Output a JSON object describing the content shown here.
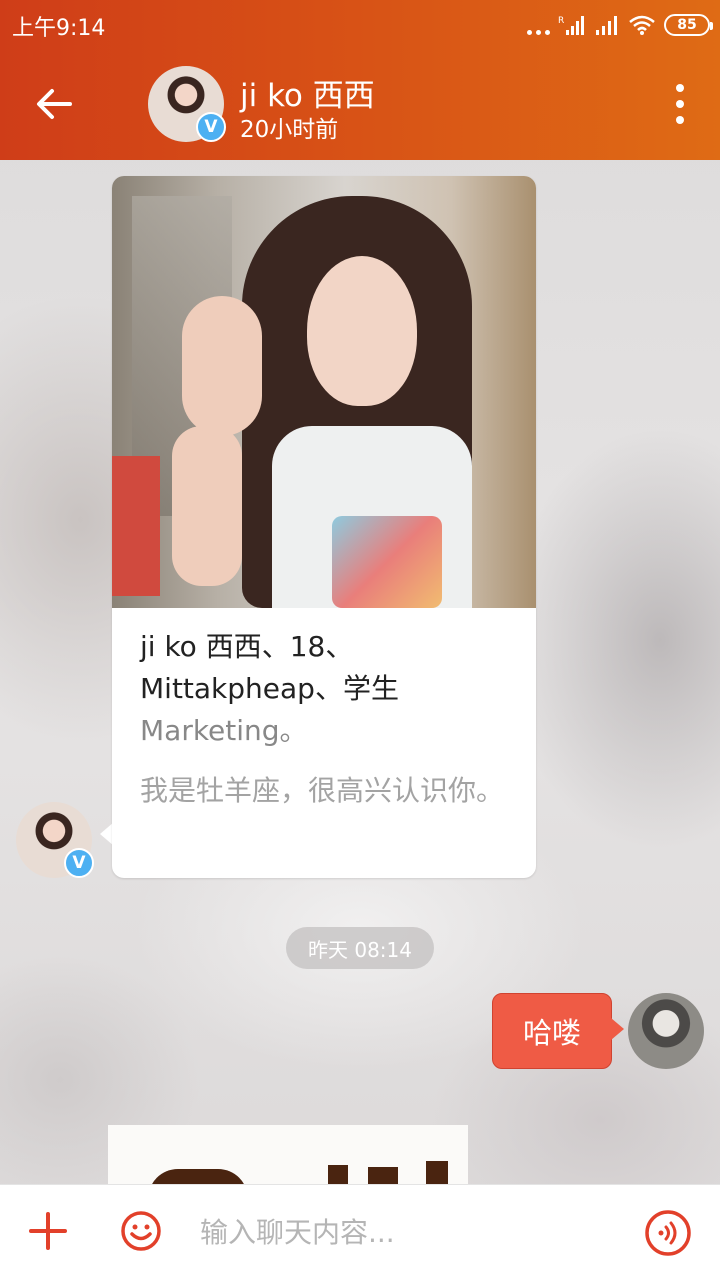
{
  "status_bar": {
    "time": "上午9:14",
    "battery": "85"
  },
  "header": {
    "contact_name": "ji ko 西西",
    "last_seen": "20小时前",
    "verified_badge": "V"
  },
  "profile_card": {
    "line1": "ji ko 西西、18、",
    "line2": "Mittakpheap、学生",
    "line3": "Marketing。",
    "bio": "我是牡羊座，很高兴认识你。"
  },
  "chat": {
    "timestamp": "昨天  08:14",
    "outgoing_message": "哈喽"
  },
  "input_bar": {
    "placeholder": "输入聊天内容..."
  },
  "colors": {
    "header_start": "#cf3d18",
    "header_end": "#df6b15",
    "accent": "#e2402a",
    "outgoing_bubble": "#ef5b45",
    "verified": "#4db0f2"
  },
  "icons": {
    "back": "arrow-left-icon",
    "more": "more-vertical-icon",
    "plus": "plus-icon",
    "emoji": "smiley-icon",
    "voice": "voice-wave-icon",
    "wifi": "wifi-icon",
    "signal": "signal-icon"
  }
}
